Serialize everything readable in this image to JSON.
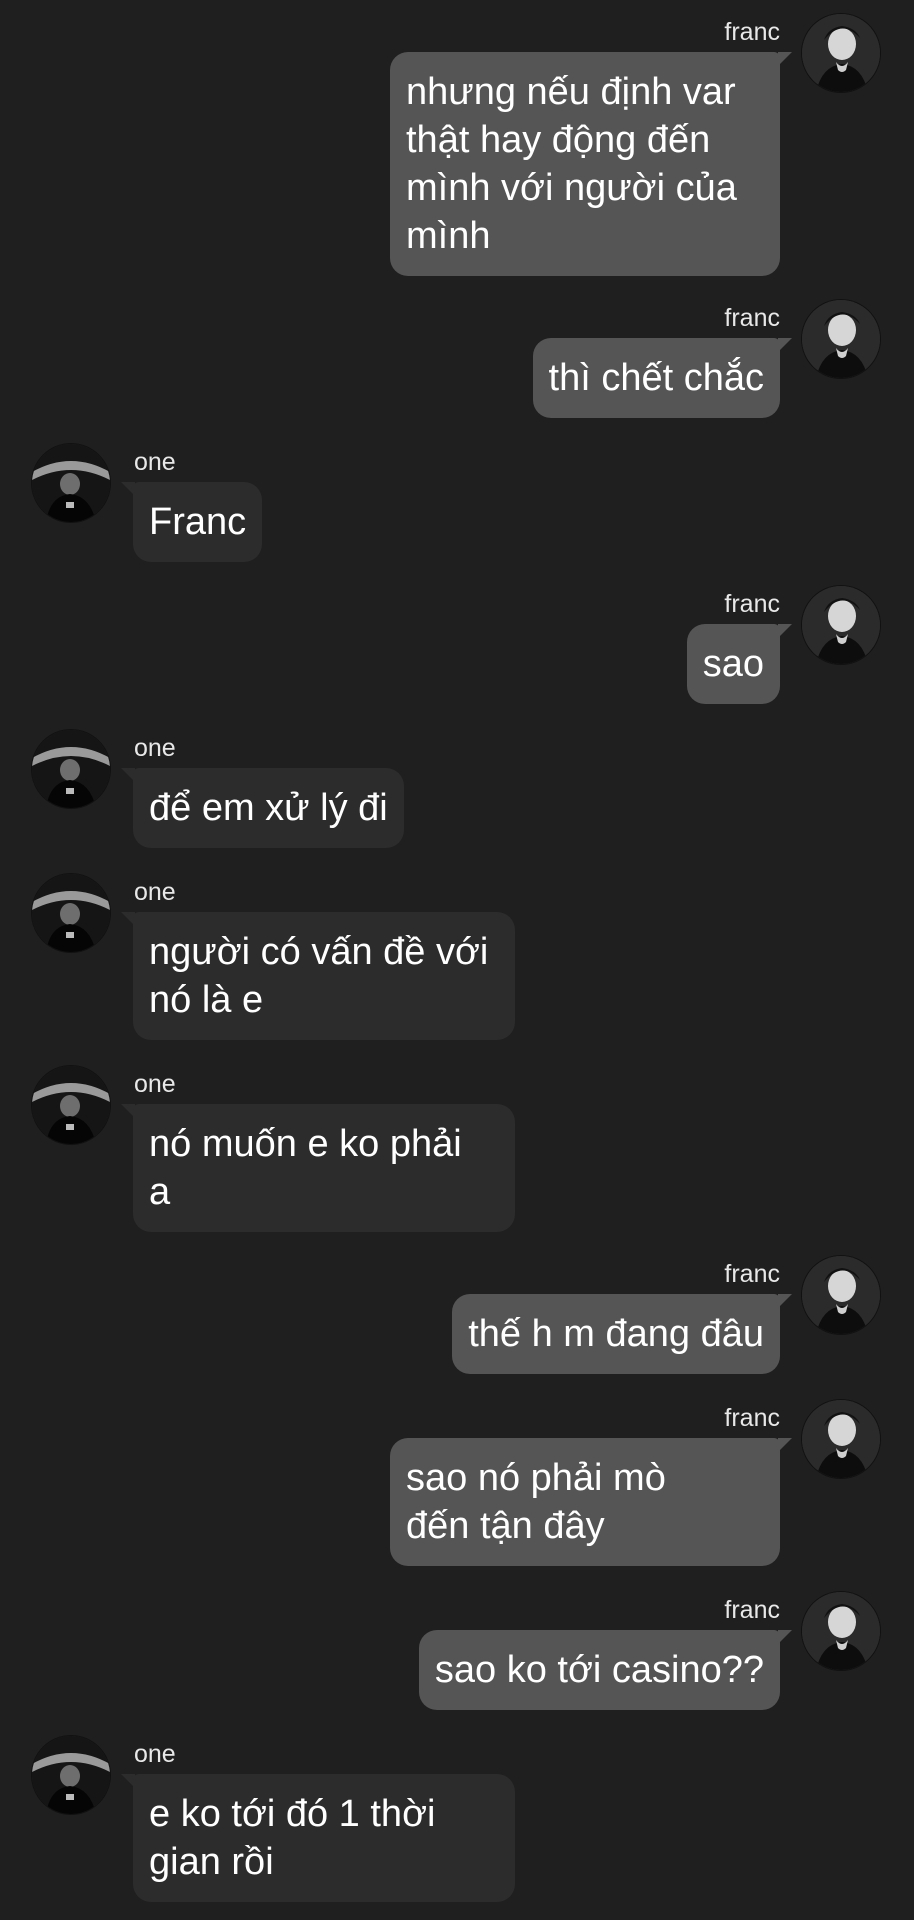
{
  "users": {
    "self": {
      "name": "franc"
    },
    "other": {
      "name": "one"
    }
  },
  "colors": {
    "background": "#1f1f1f",
    "outgoing_bubble": "#555555",
    "incoming_bubble": "#2c2c2c",
    "text": "#ffffff"
  },
  "messages": [
    {
      "sender": "franc",
      "text": "nhưng nếu định var\nthật hay động đến\nmình với người của\nmình"
    },
    {
      "sender": "franc",
      "text": "thì chết chắc"
    },
    {
      "sender": "one",
      "text": "Franc"
    },
    {
      "sender": "franc",
      "text": "sao"
    },
    {
      "sender": "one",
      "text": "để em xử lý đi"
    },
    {
      "sender": "one",
      "text": "người có vấn đề với\nnó là e"
    },
    {
      "sender": "one",
      "text": "nó muốn e ko phải\na"
    },
    {
      "sender": "franc",
      "text": "thế h m đang đâu"
    },
    {
      "sender": "franc",
      "text": "sao nó phải mò\nđến tận đây"
    },
    {
      "sender": "franc",
      "text": "sao ko tới casino??"
    },
    {
      "sender": "one",
      "text": "e ko tới đó 1 thời\ngian rồi"
    }
  ]
}
